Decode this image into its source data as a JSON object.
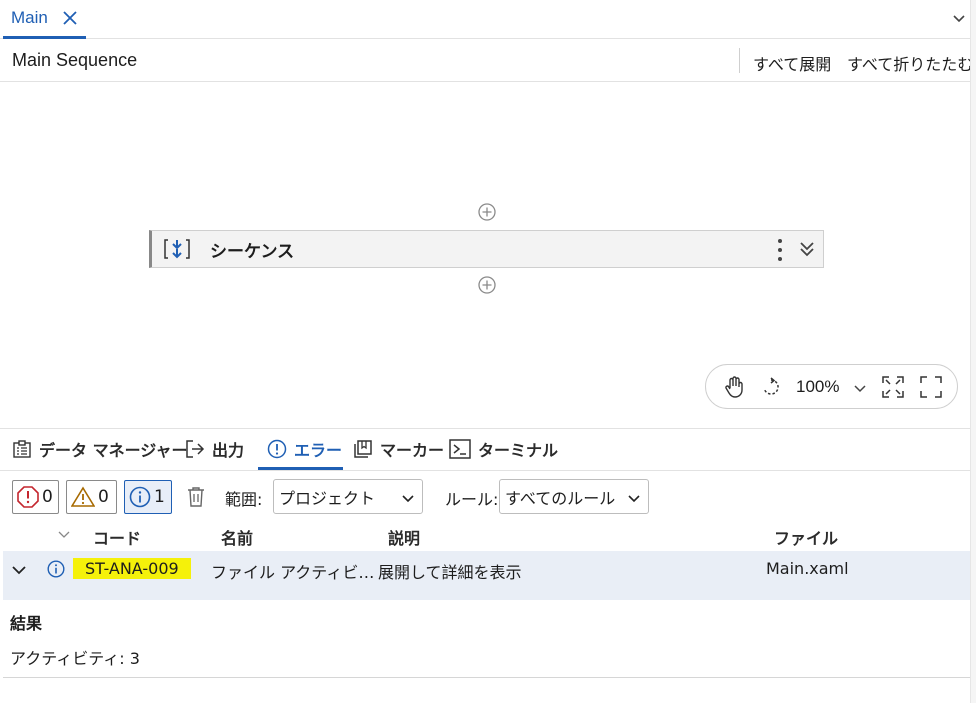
{
  "tab": {
    "label": "Main"
  },
  "sequence_header": {
    "title": "Main Sequence",
    "expand_all": "すべて展開",
    "collapse_all": "すべて折りたたむ"
  },
  "activity": {
    "label": "シーケンス"
  },
  "zoom": {
    "level": "100%"
  },
  "panel_tabs": [
    {
      "label": "データ マネージャー",
      "icon": "clipboard-icon"
    },
    {
      "label": "出力",
      "icon": "output-arrow-icon"
    },
    {
      "label": "エラー",
      "icon": "error-circle-icon",
      "active": true
    },
    {
      "label": "マーカー",
      "icon": "marker-icon"
    },
    {
      "label": "ターミナル",
      "icon": "terminal-icon"
    }
  ],
  "filters": {
    "errors_count": "0",
    "warnings_count": "0",
    "info_count": "1",
    "scope_label": "範囲:",
    "scope_value": "プロジェクト",
    "rule_label": "ルール:",
    "rule_value": "すべてのルール"
  },
  "table": {
    "headers": {
      "code": "コード",
      "name": "名前",
      "description": "説明",
      "file": "ファイル"
    },
    "rows": [
      {
        "code": "ST-ANA-009",
        "name": "ファイル アクティビ…",
        "description": "展開して詳細を表示",
        "file": "Main.xaml"
      }
    ]
  },
  "result": {
    "title": "結果",
    "line": "アクティビティ: 3"
  },
  "colors": {
    "accent": "#1f5fb4",
    "highlight": "#f5f10a",
    "row_bg": "#e9eef6",
    "error_red": "#c4262e",
    "warning": "#a76a00"
  }
}
